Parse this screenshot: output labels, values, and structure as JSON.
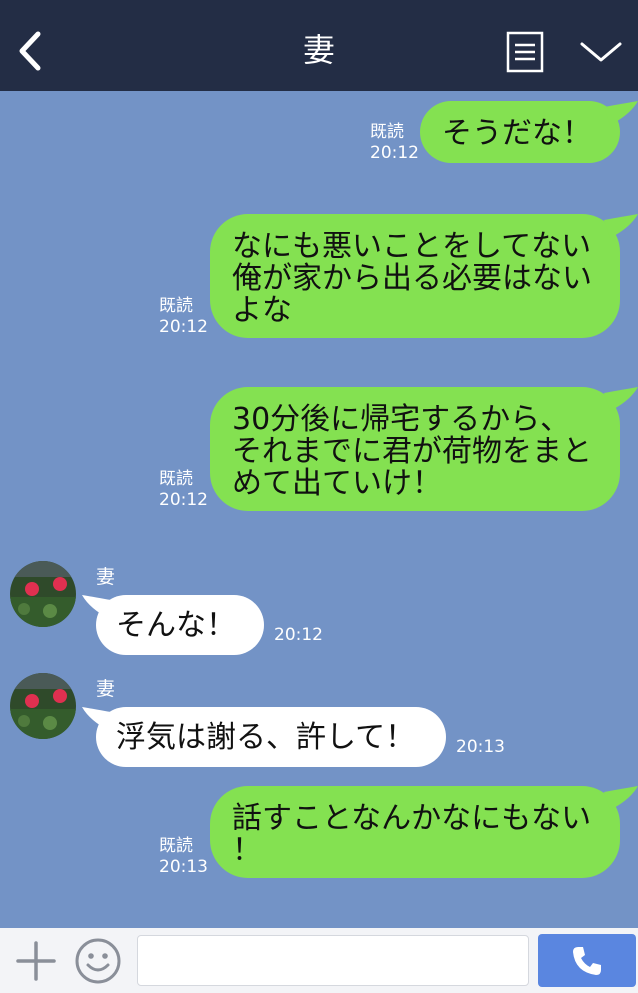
{
  "header": {
    "title": "妻"
  },
  "messages": [
    {
      "type": "sent",
      "lines": [
        "そうだな！"
      ],
      "read": "既読",
      "time": "20:12"
    },
    {
      "type": "sent",
      "lines": [
        "なにも悪いことをしてない",
        "俺が家から出る必要はない",
        "よな"
      ],
      "read": "既読",
      "time": "20:12"
    },
    {
      "type": "sent",
      "lines": [
        "30分後に帰宅するから、",
        "それまでに君が荷物をまと",
        "めて出ていけ！"
      ],
      "read": "既読",
      "time": "20:12"
    },
    {
      "type": "received",
      "sender": "妻",
      "lines": [
        "そんな！"
      ],
      "time": "20:12"
    },
    {
      "type": "received",
      "sender": "妻",
      "lines": [
        "浮気は謝る、許して！"
      ],
      "time": "20:13"
    },
    {
      "type": "sent",
      "lines": [
        "話すことなんかなにもない",
        "！"
      ],
      "read": "既読",
      "time": "20:13"
    }
  ],
  "footer": {
    "input_value": ""
  },
  "colors": {
    "background": "#7393c6",
    "header": "#232d45",
    "sent_bubble": "#84e151",
    "received_bubble": "#ffffff",
    "call_button": "#5a86e0"
  }
}
